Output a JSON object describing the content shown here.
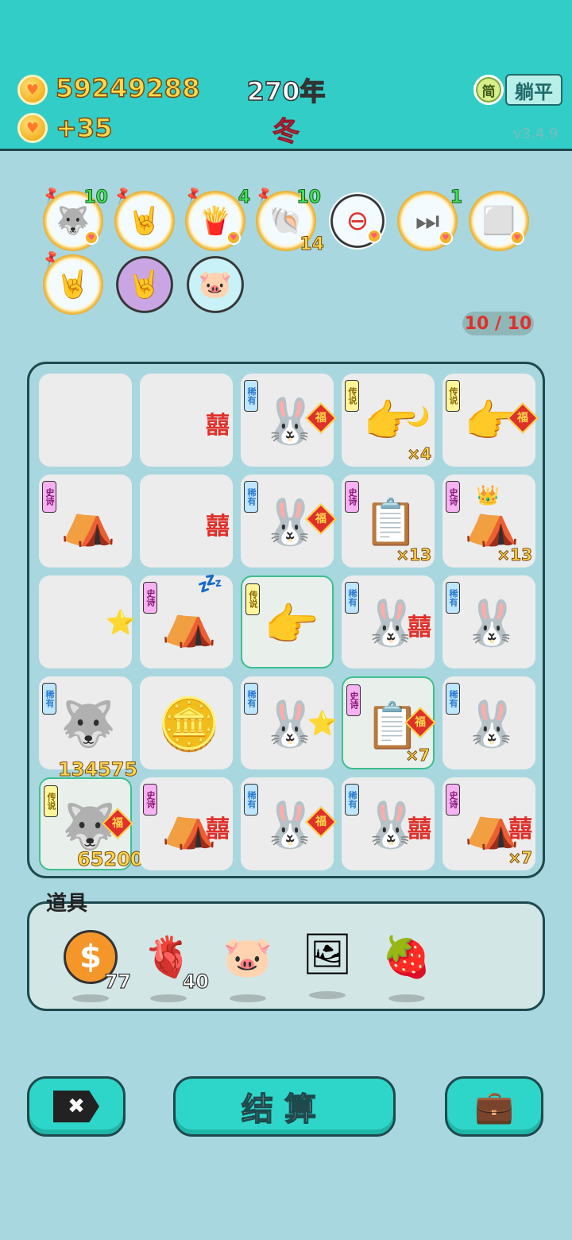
{
  "header": {
    "coin_total": "59249288",
    "coin_delta": "+35",
    "year": "270年",
    "season": "冬",
    "simplified_label": "简",
    "lie_flat_label": "躺平",
    "version": "v3.4.9"
  },
  "buffs": [
    {
      "icon": "husky",
      "glyph": "🐺",
      "count": "10"
    },
    {
      "icon": "rock-hand",
      "glyph": "🤘",
      "count": ""
    },
    {
      "icon": "fries",
      "glyph": "🍟",
      "count": "4"
    },
    {
      "icon": "shell",
      "glyph": "🐚",
      "count": "10",
      "count2": "14"
    },
    {
      "icon": "minus",
      "glyph": "⊖",
      "count": ""
    },
    {
      "icon": "skip",
      "glyph": "⏭",
      "count": "1"
    },
    {
      "icon": "sugar-cubes",
      "glyph": "⬜",
      "count": ""
    },
    {
      "icon": "rock-hand",
      "glyph": "🤘",
      "count": ""
    },
    {
      "icon": "rock-hand-purple",
      "glyph": "🤘",
      "count": ""
    },
    {
      "icon": "piggy-bank",
      "glyph": "🐷",
      "count": ""
    }
  ],
  "spin_counter": "10 / 10",
  "board": {
    "rows": [
      [
        {
          "tag": "",
          "symbol": "",
          "extra": "",
          "mult": ""
        },
        {
          "tag": "",
          "symbol": "",
          "extra": "囍",
          "mult": ""
        },
        {
          "tag": "稀有",
          "tag_type": "rare",
          "symbol": "🐰",
          "extra": "福",
          "mult": ""
        },
        {
          "tag": "传说",
          "tag_type": "legend",
          "symbol": "👉",
          "extra": "🌙",
          "mult": "×4"
        },
        {
          "tag": "传说",
          "tag_type": "legend",
          "symbol": "👉",
          "extra": "福",
          "mult": ""
        }
      ],
      [
        {
          "tag": "史诗",
          "tag_type": "epic",
          "symbol": "⛺",
          "extra": "",
          "mult": ""
        },
        {
          "tag": "",
          "symbol": "",
          "extra": "囍",
          "mult": ""
        },
        {
          "tag": "稀有",
          "tag_type": "rare",
          "symbol": "🐰",
          "extra": "福",
          "mult": ""
        },
        {
          "tag": "史诗",
          "tag_type": "epic",
          "symbol": "📋",
          "extra": "",
          "mult": "×13"
        },
        {
          "tag": "史诗",
          "tag_type": "epic",
          "symbol": "⛺",
          "extra": "👑",
          "mult": "×13"
        }
      ],
      [
        {
          "tag": "",
          "symbol": "",
          "extra": "⭐",
          "mult": ""
        },
        {
          "tag": "史诗",
          "tag_type": "epic",
          "symbol": "⛺",
          "extra": "💤",
          "mult": ""
        },
        {
          "tag": "传说",
          "tag_type": "legend",
          "symbol": "👉",
          "extra": "",
          "mult": ""
        },
        {
          "tag": "稀有",
          "tag_type": "rare",
          "symbol": "🐰",
          "extra": "囍",
          "mult": ""
        },
        {
          "tag": "稀有",
          "tag_type": "rare",
          "symbol": "🐰",
          "extra": "",
          "mult": ""
        }
      ],
      [
        {
          "tag": "稀有",
          "tag_type": "rare",
          "symbol": "🐺",
          "extra": "",
          "mult": "",
          "value": "134575"
        },
        {
          "tag": "",
          "symbol": "🪙",
          "extra": "",
          "mult": ""
        },
        {
          "tag": "稀有",
          "tag_type": "rare",
          "symbol": "🐰",
          "extra": "⭐",
          "mult": ""
        },
        {
          "tag": "史诗",
          "tag_type": "epic",
          "symbol": "📋",
          "extra": "福",
          "mult": "×7"
        },
        {
          "tag": "稀有",
          "tag_type": "rare",
          "symbol": "🐰",
          "extra": "",
          "mult": ""
        }
      ],
      [
        {
          "tag": "传说",
          "tag_type": "legend",
          "symbol": "🐺",
          "extra": "福",
          "mult": "",
          "value": "65200"
        },
        {
          "tag": "史诗",
          "tag_type": "epic",
          "symbol": "⛺",
          "extra": "囍",
          "mult": ""
        },
        {
          "tag": "稀有",
          "tag_type": "rare",
          "symbol": "🐰",
          "extra": "福",
          "mult": ""
        },
        {
          "tag": "稀有",
          "tag_type": "rare",
          "symbol": "🐰",
          "extra": "囍",
          "mult": ""
        },
        {
          "tag": "史诗",
          "tag_type": "epic",
          "symbol": "⛺",
          "extra": "囍",
          "mult": "×7"
        }
      ]
    ]
  },
  "items_title": "道具",
  "items": [
    {
      "icon": "dollar-coin",
      "glyph": "$",
      "qty": "77"
    },
    {
      "icon": "liver",
      "glyph": "🫀",
      "qty": "40"
    },
    {
      "icon": "piggy-bank",
      "glyph": "🐷",
      "qty": ""
    },
    {
      "icon": "rabbit-frame",
      "glyph": "🖼",
      "qty": ""
    },
    {
      "icon": "bayberry",
      "glyph": "🍓",
      "qty": ""
    }
  ],
  "buttons": {
    "close_glyph": "✖",
    "settle_label": "结算",
    "bag_glyph": "💼"
  },
  "colors": {
    "topbar": "#33cdc7",
    "background": "#a9d7df",
    "coin_text": "#ffd84a",
    "season_text": "#ff3d5a",
    "counter_text": "#e0302a"
  }
}
